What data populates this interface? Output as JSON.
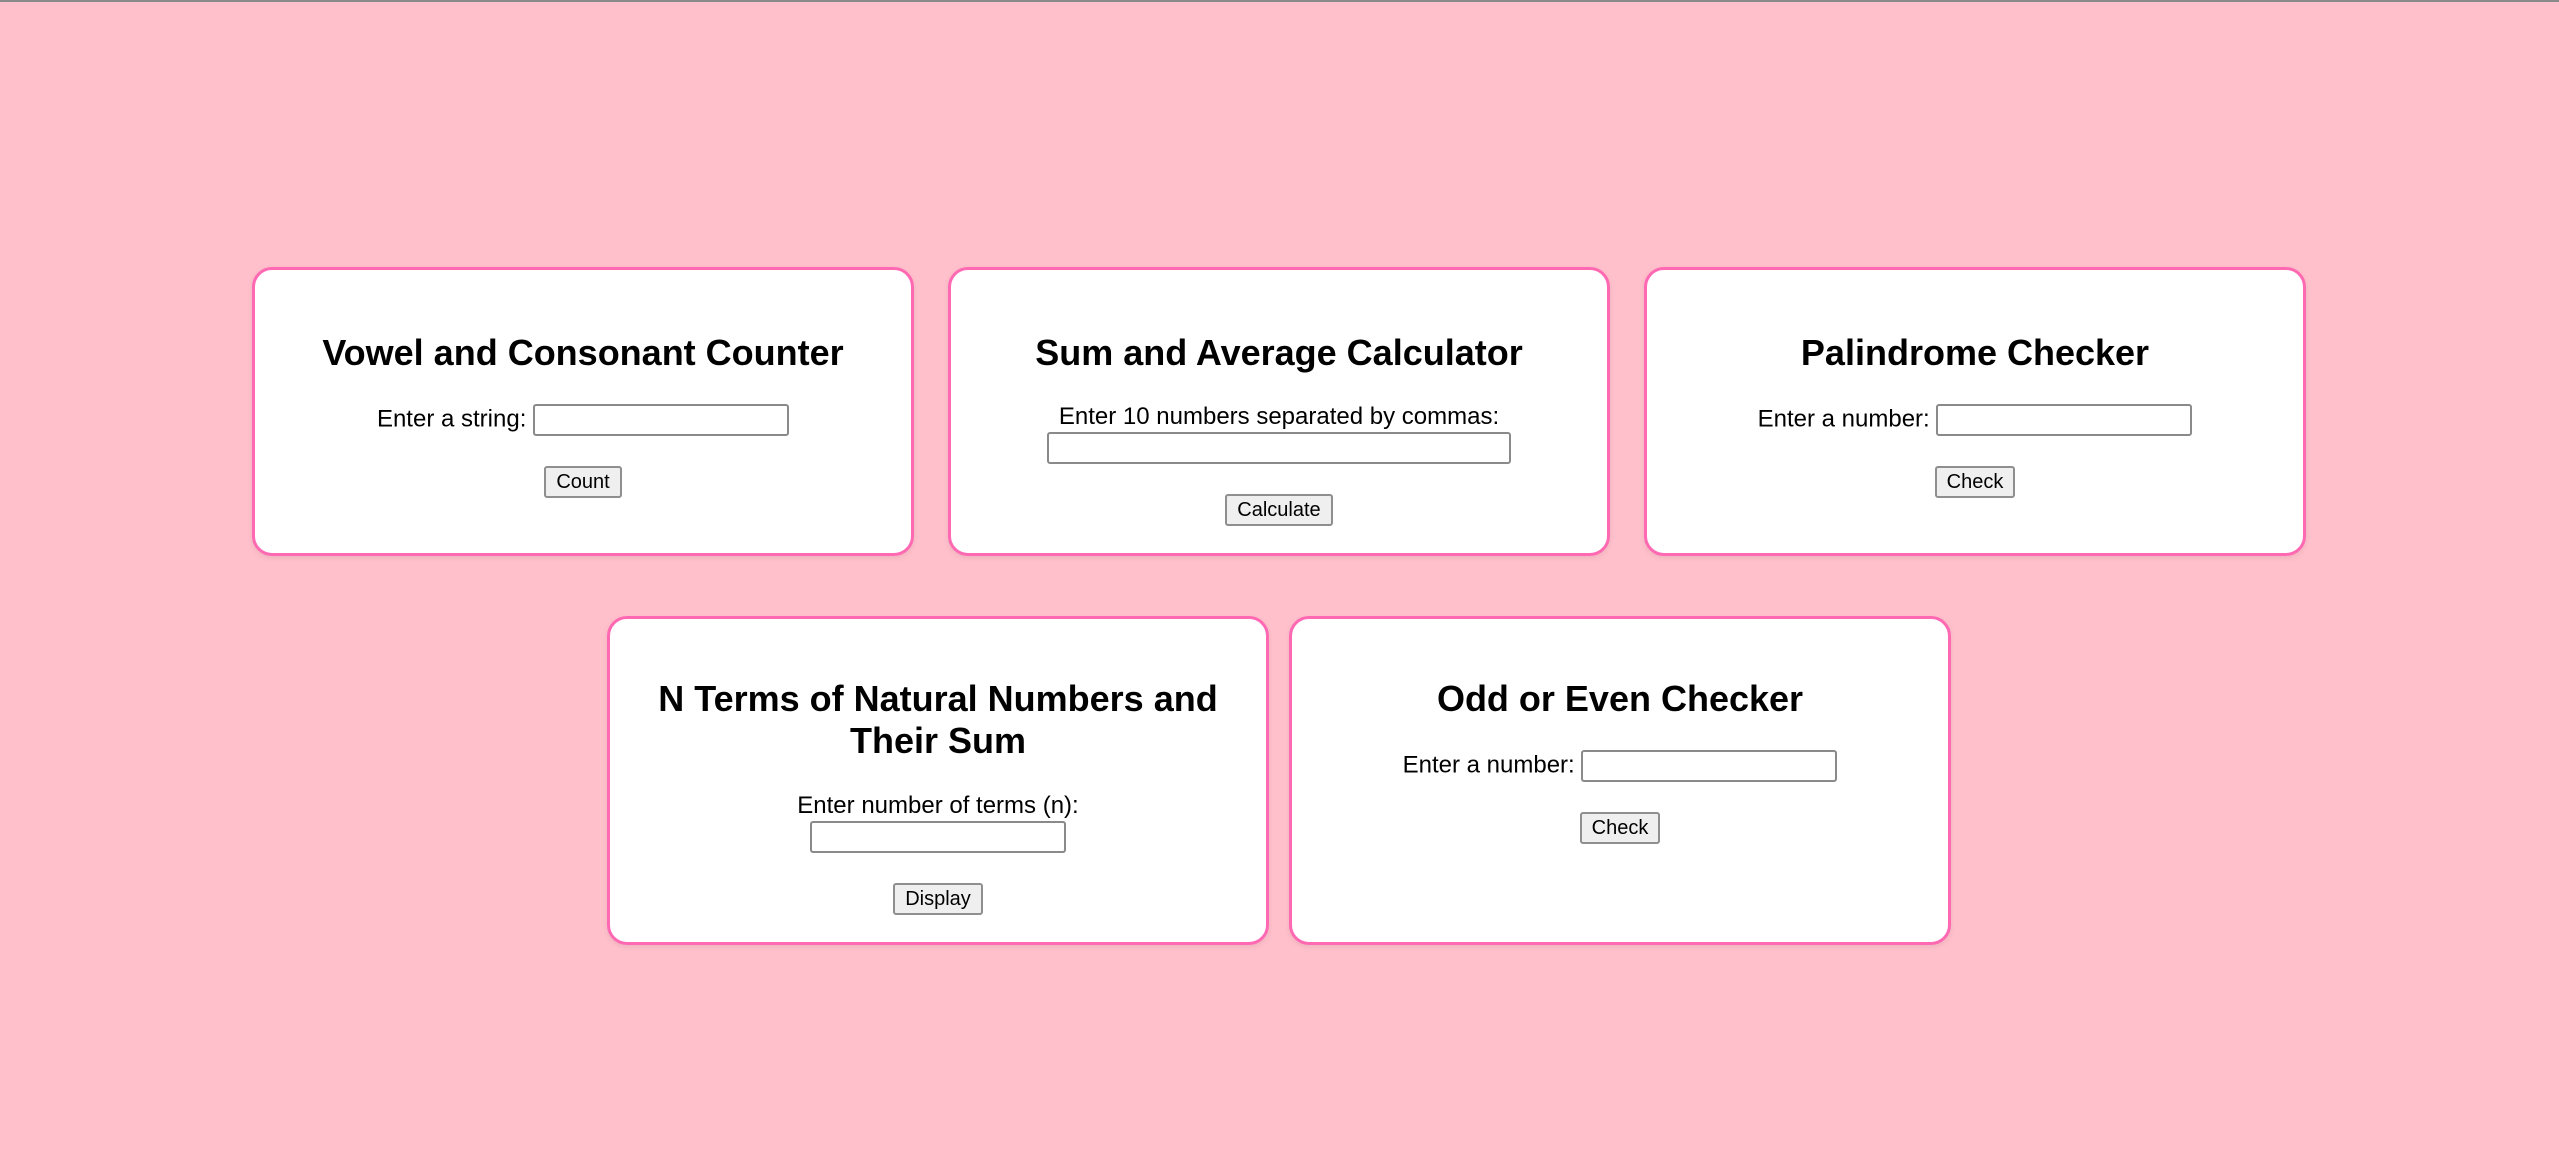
{
  "cards": [
    {
      "title": "Vowel and Consonant Counter",
      "label": "Enter a string:",
      "value": "",
      "button": "Count"
    },
    {
      "title": "Sum and Average Calculator",
      "label": "Enter 10 numbers separated by commas:",
      "value": "",
      "button": "Calculate"
    },
    {
      "title": "Palindrome Checker",
      "label": "Enter a number:",
      "value": "",
      "button": "Check"
    },
    {
      "title": "N Terms of Natural Numbers and Their Sum",
      "label": "Enter number of terms (n):",
      "value": "",
      "button": "Display"
    },
    {
      "title": "Odd or Even Checker",
      "label": "Enter a number:",
      "value": "",
      "button": "Check"
    }
  ],
  "colors": {
    "background": "#ffc0cb",
    "card_border": "#ff69b4",
    "card_background": "#ffffff"
  }
}
